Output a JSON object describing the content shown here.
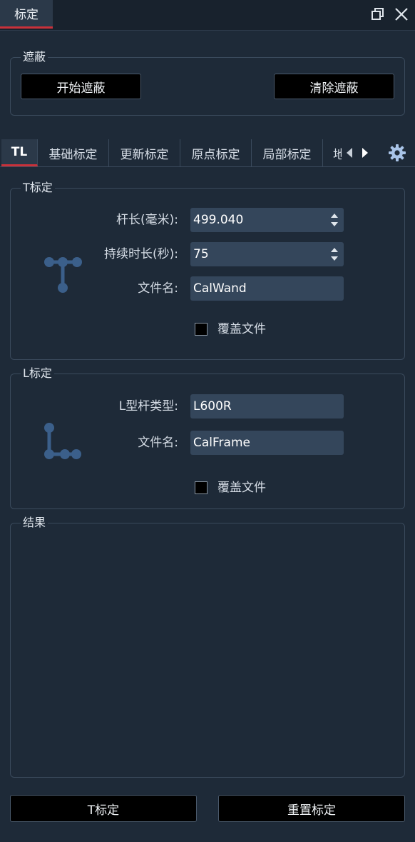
{
  "window": {
    "title": "标定",
    "restore_icon": "restore-window-icon",
    "close_icon": "close-icon"
  },
  "mask": {
    "group_label": "遮蔽",
    "start_label": "开始遮蔽",
    "clear_label": "清除遮蔽"
  },
  "tabs": [
    {
      "label": "TL",
      "active": true
    },
    {
      "label": "基础标定",
      "active": false
    },
    {
      "label": "更新标定",
      "active": false
    },
    {
      "label": "原点标定",
      "active": false
    },
    {
      "label": "局部标定",
      "active": false
    },
    {
      "label": "地",
      "active": false
    }
  ],
  "tab_nav": {
    "prev_icon": "triangle-left-icon",
    "next_icon": "triangle-right-icon",
    "settings_icon": "gear-icon"
  },
  "t_calibration": {
    "group_label": "T标定",
    "wand_length_label": "杆长(毫米):",
    "wand_length_value": "499.040",
    "duration_label": "持续时长(秒):",
    "duration_value": "75",
    "filename_label": "文件名:",
    "filename_value": "CalWand",
    "overwrite_label": "覆盖文件",
    "overwrite_checked": false,
    "icon": "t-wand-icon"
  },
  "l_calibration": {
    "group_label": "L标定",
    "type_label": "L型杆类型:",
    "type_value": "L600R",
    "filename_label": "文件名:",
    "filename_value": "CalFrame",
    "overwrite_label": "覆盖文件",
    "overwrite_checked": false,
    "icon": "l-frame-icon"
  },
  "results": {
    "group_label": "结果"
  },
  "footer": {
    "t_calibrate_label": "T标定",
    "reset_label": "重置标定"
  },
  "colors": {
    "background": "#1e2a38",
    "accent_red": "#c9313a",
    "field_bg": "#34465b",
    "icon_blue": "#3b5f8a"
  }
}
